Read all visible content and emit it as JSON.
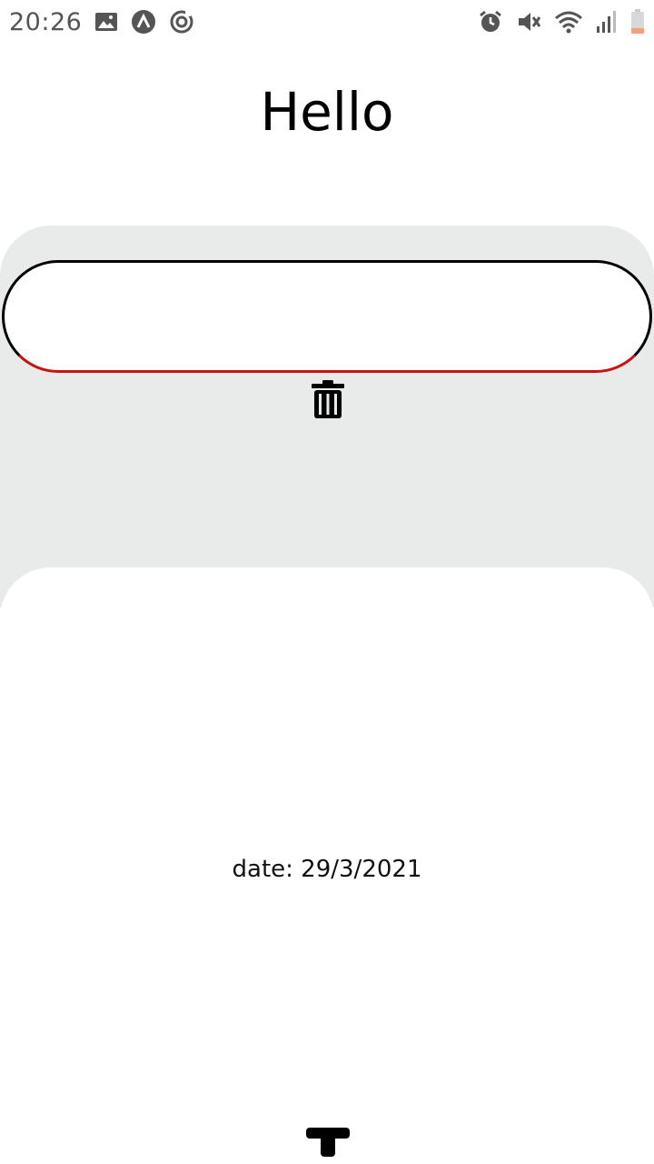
{
  "status_bar": {
    "time": "20:26",
    "left_icons": [
      "image-icon",
      "app-a-icon",
      "sync-icon"
    ],
    "right_icons": [
      "alarm-icon",
      "mute-icon",
      "wifi-icon",
      "signal-icon",
      "battery-icon"
    ]
  },
  "header": {
    "title": "Hello"
  },
  "editor": {
    "input_value": "",
    "input_placeholder": "",
    "border_color": "#000000",
    "underline_color": "#cc1111",
    "delete_icon": "trash-icon"
  },
  "content": {
    "date_text": "date: 29/3/2021"
  },
  "footer": {
    "icon": "text-t-icon"
  },
  "colors": {
    "grey_card": "#e9eaea",
    "background": "#ffffff"
  }
}
